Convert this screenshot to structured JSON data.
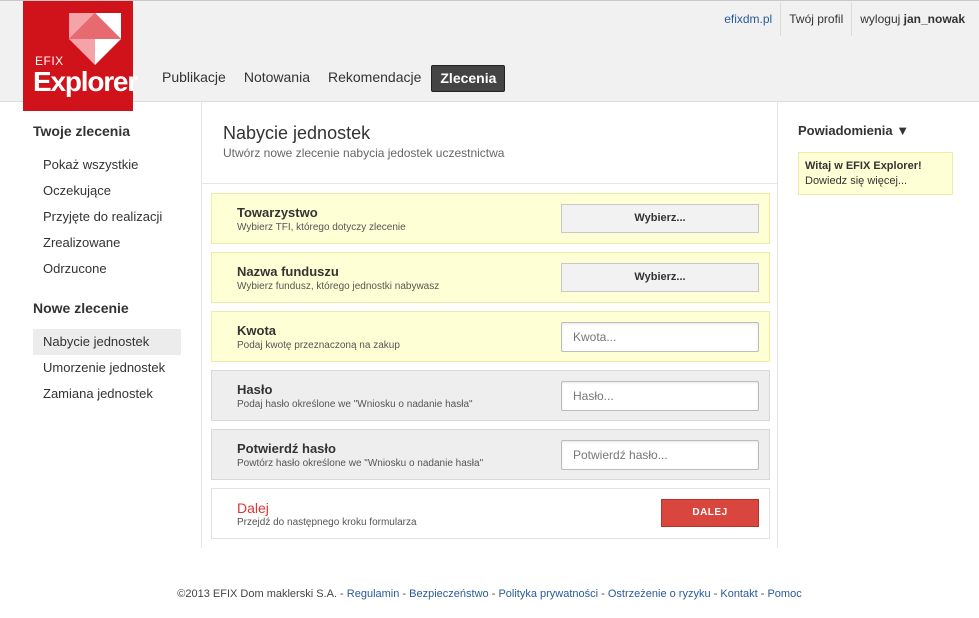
{
  "logo": {
    "small": "EFIX",
    "big": "Explorer"
  },
  "toplinks": {
    "site": "efixdm.pl",
    "profile": "Twój profil",
    "logout_prefix": "wyloguj",
    "user": "jan_nowak"
  },
  "nav": {
    "items": [
      "Publikacje",
      "Notowania",
      "Rekomendacje",
      "Zlecenia"
    ],
    "active": "Zlecenia"
  },
  "leftnav": {
    "section1": {
      "title": "Twoje zlecenia",
      "items": [
        "Pokaż wszystkie",
        "Oczekujące",
        "Przyjęte do realizacji",
        "Zrealizowane",
        "Odrzucone"
      ]
    },
    "section2": {
      "title": "Nowe zlecenie",
      "items": [
        "Nabycie jednostek",
        "Umorzenie jednostek",
        "Zamiana jednostek"
      ],
      "active": "Nabycie jednostek"
    }
  },
  "content": {
    "title": "Nabycie jednostek",
    "subtitle": "Utwórz nowe zlecenie nabycia jedostek uczestnictwa",
    "rows": [
      {
        "label": "Towarzystwo",
        "desc": "Wybierz TFI, którego dotyczy zlecenie",
        "button": "Wybierz..."
      },
      {
        "label": "Nazwa funduszu",
        "desc": "Wybierz fundusz, którego jednostki nabywasz",
        "button": "Wybierz..."
      },
      {
        "label": "Kwota",
        "desc": "Podaj kwotę przeznaczoną na zakup",
        "placeholder": "Kwota..."
      },
      {
        "label": "Hasło",
        "desc": "Podaj hasło określone we \"Wniosku o nadanie hasła\"",
        "placeholder": "Hasło..."
      },
      {
        "label": "Potwierdź hasło",
        "desc": "Powtórz hasło określone we \"Wniosku o nadanie hasła\"",
        "placeholder": "Potwierdź hasło..."
      },
      {
        "label": "Dalej",
        "desc": "Przejdź do następnego kroku formularza",
        "button": "DALEJ"
      }
    ]
  },
  "notifications": {
    "title": "Powiadomienia ▼",
    "headline": "Witaj w EFIX Explorer!",
    "more": "Dowiedz się więcej..."
  },
  "footer": {
    "copyright": "©2013 EFIX Dom maklerski S.A.",
    "links": [
      "Regulamin",
      "Bezpieczeństwo",
      "Polityka prywatności",
      "Ostrzeżenie o ryzyku",
      "Kontakt",
      "Pomoc"
    ]
  },
  "colors": {
    "brand": "#d0121b",
    "link": "#2a5a9a",
    "highlight": "#ffffd6",
    "danger": "#d9463d"
  }
}
